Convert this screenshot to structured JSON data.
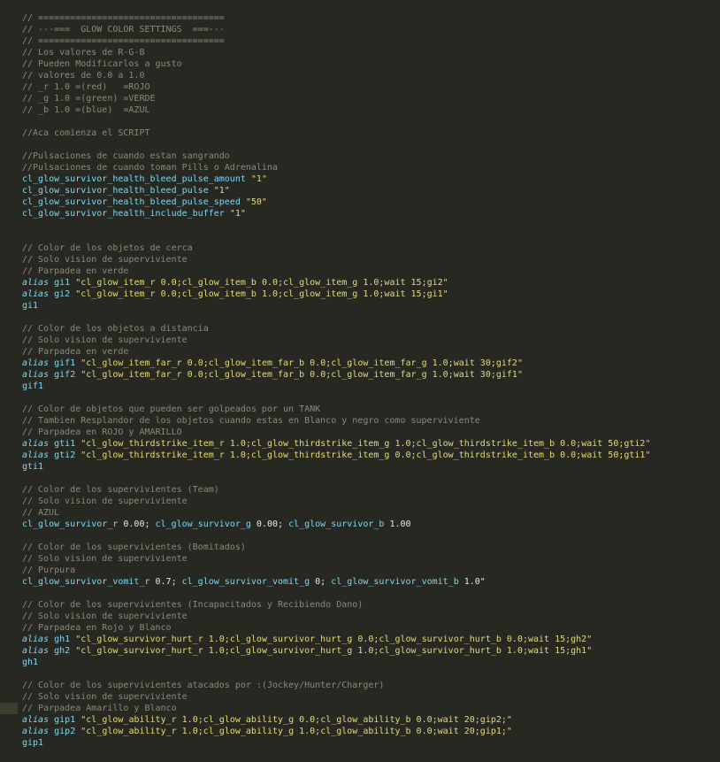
{
  "lines": [
    {
      "type": "comment",
      "text": "// ==================================="
    },
    {
      "type": "comment",
      "text": "// ---===  GLOW COLOR SETTINGS  ===---"
    },
    {
      "type": "comment",
      "text": "// ==================================="
    },
    {
      "type": "comment",
      "text": "// Los valores de R-G-B"
    },
    {
      "type": "comment",
      "text": "// Pueden Modificarlos a gusto"
    },
    {
      "type": "comment",
      "text": "// valores de 0.0 a 1.0"
    },
    {
      "type": "comment",
      "text": "// _r 1.0 =(red)   =ROJO"
    },
    {
      "type": "comment",
      "text": "// _g 1.0 =(green) =VERDE"
    },
    {
      "type": "comment",
      "text": "// _b 1.0 =(blue)  =AZUL"
    },
    {
      "type": "blank"
    },
    {
      "type": "comment",
      "text": "//Aca comienza el SCRIPT"
    },
    {
      "type": "blank"
    },
    {
      "type": "comment",
      "text": "//Pulsaciones de cuando estan sangrando"
    },
    {
      "type": "comment",
      "text": "//Pulsaciones de cuando toman Pills o Adrenalina"
    },
    {
      "type": "cvar",
      "name": "cl_glow_survivor_health_bleed_pulse_amount",
      "value": "\"1\""
    },
    {
      "type": "cvar",
      "name": "cl_glow_survivor_health_bleed_pulse",
      "value": "\"1\""
    },
    {
      "type": "cvar",
      "name": "cl_glow_survivor_health_bleed_pulse_speed",
      "value": "\"50\""
    },
    {
      "type": "cvar",
      "name": "cl_glow_survivor_health_include_buffer",
      "value": "\"1\""
    },
    {
      "type": "blank"
    },
    {
      "type": "blank"
    },
    {
      "type": "comment",
      "text": "// Color de los objetos de cerca"
    },
    {
      "type": "comment",
      "text": "// Solo vision de superviviente"
    },
    {
      "type": "comment",
      "text": "// Parpadea en verde"
    },
    {
      "type": "alias",
      "keyword": "alias",
      "name": "gi1",
      "value": "\"cl_glow_item_r 0.0;cl_glow_item_b 0.0;cl_glow_item_g 1.0;wait 15;gi2\""
    },
    {
      "type": "alias",
      "keyword": "alias",
      "name": "gi2",
      "value": "\"cl_glow_item_r 0.0;cl_glow_item_b 1.0;cl_glow_item_g 1.0;wait 15;gi1\""
    },
    {
      "type": "call",
      "text": "gi1"
    },
    {
      "type": "blank"
    },
    {
      "type": "comment",
      "text": "// Color de los objetos a distancia"
    },
    {
      "type": "comment",
      "text": "// Solo vision de superviviente"
    },
    {
      "type": "comment",
      "text": "// Parpadea en verde"
    },
    {
      "type": "alias",
      "keyword": "alias",
      "name": "gif1",
      "value": "\"cl_glow_item_far_r 0.0;cl_glow_item_far_b 0.0;cl_glow_item_far_g 1.0;wait 30;gif2\""
    },
    {
      "type": "alias",
      "keyword": "alias",
      "name": "gif2",
      "value": "\"cl_glow_item_far_r 0.0;cl_glow_item_far_b 0.0;cl_glow_item_far_g 1.0;wait 30;gif1\""
    },
    {
      "type": "call",
      "text": "gif1"
    },
    {
      "type": "blank"
    },
    {
      "type": "comment",
      "text": "// Color de objetos que pueden ser golpeados por un TANK"
    },
    {
      "type": "comment",
      "text": "// Tambien Resplandor de los objetos cuando estas en Blanco y negro como superviviente"
    },
    {
      "type": "comment",
      "text": "// Parpadea en ROJO y AMARILLO"
    },
    {
      "type": "alias",
      "keyword": "alias",
      "name": "gti1",
      "value": "\"cl_glow_thirdstrike_item_r 1.0;cl_glow_thirdstrike_item_g 1.0;cl_glow_thirdstrike_item_b 0.0;wait 50;gti2\""
    },
    {
      "type": "alias",
      "keyword": "alias",
      "name": "gti2",
      "value": "\"cl_glow_thirdstrike_item_r 1.0;cl_glow_thirdstrike_item_g 0.0;cl_glow_thirdstrike_item_b 0.0;wait 50;gti1\""
    },
    {
      "type": "call",
      "text": "gti1"
    },
    {
      "type": "blank"
    },
    {
      "type": "comment",
      "text": "// Color de los supervivientes (Team)"
    },
    {
      "type": "comment",
      "text": "// Solo vision de superviviente"
    },
    {
      "type": "comment",
      "text": "// AZUL"
    },
    {
      "type": "multi",
      "parts": [
        {
          "cls": "cvar",
          "text": "cl_glow_survivor_r"
        },
        {
          "cls": "plain",
          "text": " 0.00; "
        },
        {
          "cls": "cvar",
          "text": "cl_glow_survivor_g"
        },
        {
          "cls": "plain",
          "text": " 0.00; "
        },
        {
          "cls": "cvar",
          "text": "cl_glow_survivor_b"
        },
        {
          "cls": "plain",
          "text": " 1.00"
        }
      ]
    },
    {
      "type": "blank"
    },
    {
      "type": "comment",
      "text": "// Color de los supervivientes (Bomitados)"
    },
    {
      "type": "comment",
      "text": "// Solo vision de superviviente"
    },
    {
      "type": "comment",
      "text": "// Purpura"
    },
    {
      "type": "multi",
      "parts": [
        {
          "cls": "cvar",
          "text": "cl_glow_survivor_vomit_r"
        },
        {
          "cls": "plain",
          "text": " 0.7; "
        },
        {
          "cls": "cvar",
          "text": "cl_glow_survivor_vomit_g"
        },
        {
          "cls": "plain",
          "text": " 0; "
        },
        {
          "cls": "cvar",
          "text": "cl_glow_survivor_vomit_b"
        },
        {
          "cls": "plain",
          "text": " 1.0\""
        }
      ]
    },
    {
      "type": "blank"
    },
    {
      "type": "comment",
      "text": "// Color de los supervivientes (Incapacitados y Recibiendo Dano)"
    },
    {
      "type": "comment",
      "text": "// Solo vision de superviviente"
    },
    {
      "type": "comment",
      "text": "// Parpadea en Rojo y Blanco"
    },
    {
      "type": "alias",
      "keyword": "alias",
      "name": "gh1",
      "value": "\"cl_glow_survivor_hurt_r 1.0;cl_glow_survivor_hurt_g 0.0;cl_glow_survivor_hurt_b 0.0;wait 15;gh2\""
    },
    {
      "type": "alias",
      "keyword": "alias",
      "name": "gh2",
      "value": "\"cl_glow_survivor_hurt_r 1.0;cl_glow_survivor_hurt_g 1.0;cl_glow_survivor_hurt_b 1.0;wait 15;gh1\""
    },
    {
      "type": "call",
      "text": "gh1"
    },
    {
      "type": "blank"
    },
    {
      "type": "comment",
      "text": "// Color de los supervivientes atacados por :(Jockey/Hunter/Charger)"
    },
    {
      "type": "comment",
      "text": "// Solo vision de superviviente"
    },
    {
      "type": "comment",
      "text": "// Parpadea Amarillo y Blanco"
    },
    {
      "type": "alias",
      "keyword": "alias",
      "name": "gip1",
      "value": "\"cl_glow_ability_r 1.0;cl_glow_ability_g 0.0;cl_glow_ability_b 0.0;wait 20;gip2;\""
    },
    {
      "type": "alias",
      "keyword": "alias",
      "name": "gip2",
      "value": "\"cl_glow_ability_r 1.0;cl_glow_ability_g 1.0;cl_glow_ability_b 0.0;wait 20;gip1;\""
    },
    {
      "type": "call",
      "text": "gip1"
    }
  ],
  "colors": {
    "background": "#272822",
    "comment": "#8a8a7a",
    "identifier": "#7fd7f2",
    "string": "#e6db74",
    "plain": "#e8e8e2",
    "current_line_marker": "#3e3d32"
  }
}
